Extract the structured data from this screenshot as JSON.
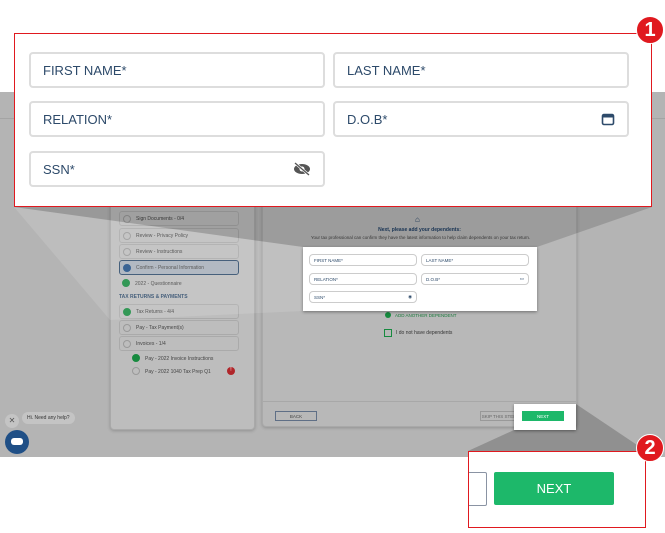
{
  "callout1": {
    "badge": "1",
    "fields": {
      "first_name": "FIRST NAME*",
      "last_name": "LAST NAME*",
      "relation": "RELATION*",
      "dob": "D.O.B*",
      "ssn": "SSN*"
    }
  },
  "callout2": {
    "badge": "2",
    "next": "NEXT"
  },
  "sidebar": {
    "items": [
      {
        "label": "Sign Documents - 0/4"
      },
      {
        "label": "Review - Privacy Policy"
      },
      {
        "label": "Review - Instructions"
      },
      {
        "label": "Confirm - Personal Information"
      },
      {
        "label": "2022 - Questionnaire"
      }
    ],
    "section": "TAX RETURNS & PAYMENTS",
    "items2": [
      {
        "label": "Tax Returns - 4/4"
      },
      {
        "label": "Pay - Tax Payment(s)"
      },
      {
        "label": "Invoices - 1/4"
      },
      {
        "label": "Pay - 2022 Invoice Instructions"
      },
      {
        "label": "Pay - 2022 1040 Tax Prep Q1"
      }
    ],
    "alert_count": "!"
  },
  "main": {
    "heading": "Next, please add your dependents:",
    "subtext": "Your tax professional can confirm they have the latest information to help claim dependents on your tax return.",
    "add_another": "ADD ANOTHER DEPENDENT",
    "no_dependents": "I do not have dependents",
    "back": "BACK",
    "skip": "SKIP THIS STEP",
    "next": "NEXT"
  },
  "chat": {
    "greeting": "Hi. Need any help?"
  }
}
